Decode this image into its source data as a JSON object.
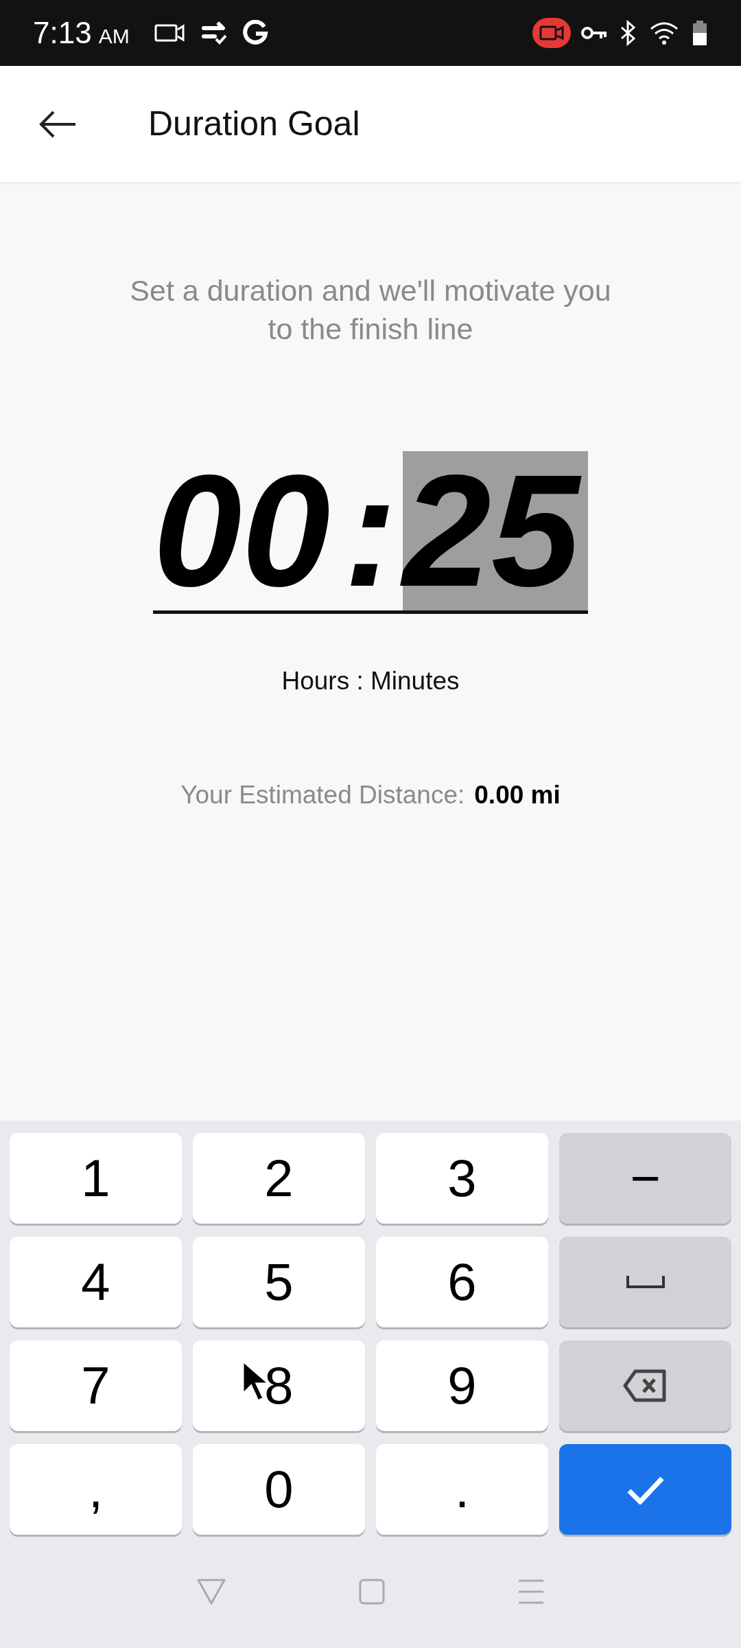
{
  "status_bar": {
    "time": "7:13",
    "meridiem": "AM"
  },
  "app_bar": {
    "title": "Duration Goal"
  },
  "subtitle": "Set a duration and we'll motivate you to the finish line",
  "timer": {
    "segments": [
      {
        "value": "00",
        "selected": false
      },
      {
        "value": "25",
        "selected": true
      }
    ],
    "separator": ":"
  },
  "timer_label": "Hours : Minutes",
  "distance": {
    "label": "Your Estimated Distance:",
    "value": "0.00 mi"
  },
  "keyboard": {
    "keys": [
      {
        "kind": "digit",
        "label": "1"
      },
      {
        "kind": "digit",
        "label": "2"
      },
      {
        "kind": "digit",
        "label": "3"
      },
      {
        "kind": "symbol",
        "label": "−"
      },
      {
        "kind": "digit",
        "label": "4"
      },
      {
        "kind": "digit",
        "label": "5"
      },
      {
        "kind": "digit",
        "label": "6"
      },
      {
        "kind": "space"
      },
      {
        "kind": "digit",
        "label": "7"
      },
      {
        "kind": "digit",
        "label": "8"
      },
      {
        "kind": "digit",
        "label": "9"
      },
      {
        "kind": "backspace"
      },
      {
        "kind": "digit",
        "label": ","
      },
      {
        "kind": "digit",
        "label": "0"
      },
      {
        "kind": "digit",
        "label": "."
      },
      {
        "kind": "done"
      }
    ]
  }
}
